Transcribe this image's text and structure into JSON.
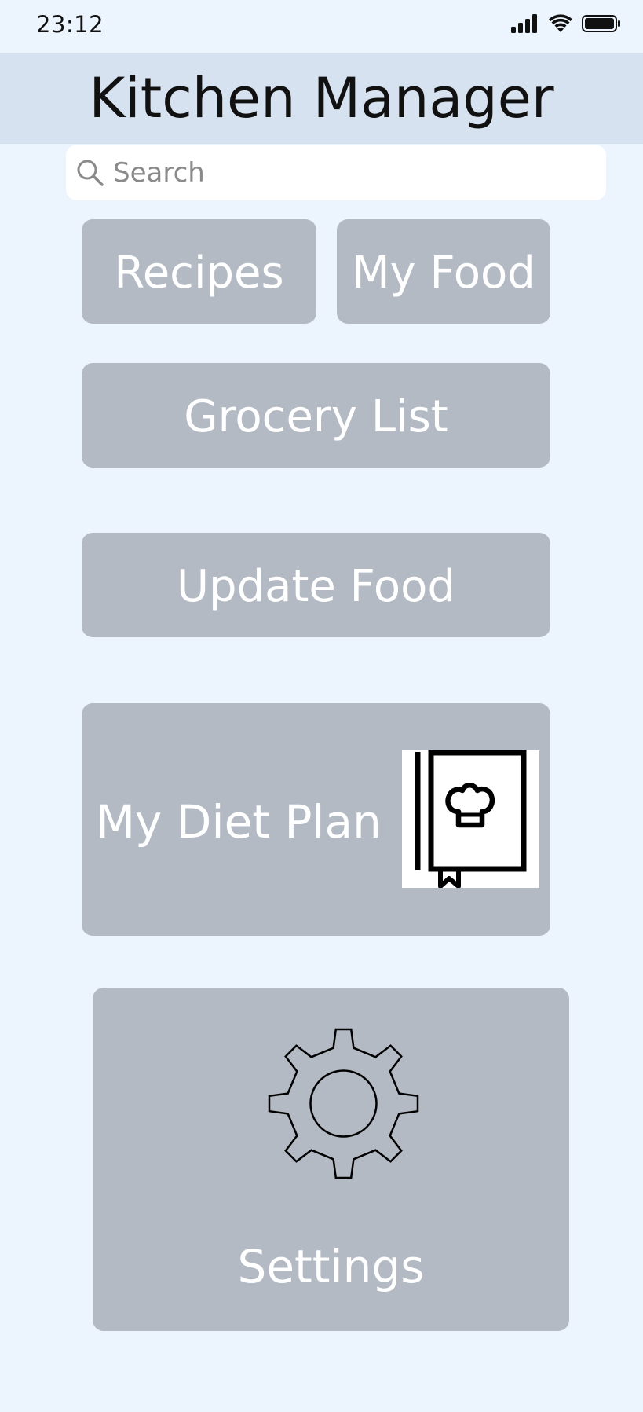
{
  "status_bar": {
    "time": "23:12",
    "icons": [
      "signal-icon",
      "wifi-icon",
      "battery-icon"
    ]
  },
  "header": {
    "title": "Kitchen Manager"
  },
  "search": {
    "placeholder": "Search",
    "value": ""
  },
  "tiles": {
    "recipes": "Recipes",
    "my_food": "My Food",
    "grocery_list": "Grocery List",
    "update_food": "Update Food",
    "diet_plan": "My Diet Plan",
    "diet_plan_icon": "chef-hat-book-icon",
    "settings": "Settings",
    "settings_icon": "gear-icon"
  },
  "colors": {
    "background": "#ecf4fe",
    "header_bg": "#d6e2ef",
    "tile_bg": "#b3bac4",
    "tile_text": "#ffffff"
  }
}
